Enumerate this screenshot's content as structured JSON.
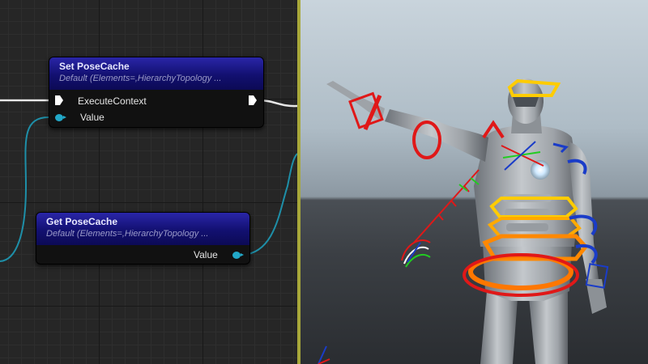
{
  "graph": {
    "set_node": {
      "title": "Set PoseCache",
      "subtitle": "Default (Elements=,HierarchyTopology ...",
      "exec_label": "ExecuteContext",
      "value_label": "Value"
    },
    "get_node": {
      "title": "Get PoseCache",
      "subtitle": "Default (Elements=,HierarchyTopology ...",
      "value_label": "Value"
    },
    "colors": {
      "node_header": "#1a1890",
      "data_pin": "#22a8c8",
      "exec_wire": "#ffffff",
      "divider": "#a8a83a"
    }
  },
  "viewport": {
    "subject": "mannequin-character-with-control-rig",
    "gizmo_colors": [
      "#e01818",
      "#ffcc00",
      "#ff8800",
      "#1a3cc8",
      "#22cc22"
    ]
  }
}
